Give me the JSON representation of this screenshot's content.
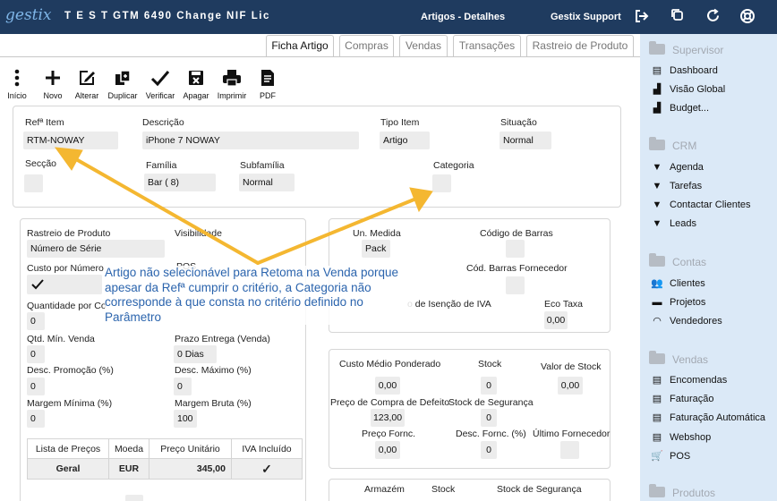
{
  "header": {
    "logo": "gestix",
    "document_title": "T E S T GTM 6490 Change NIF Lic",
    "window_title": "Artigos - Detalhes",
    "user": "Gestix Support",
    "icons": [
      "logout-icon",
      "windows-icon",
      "refresh-icon",
      "help-icon"
    ]
  },
  "tabs": [
    {
      "label": "Ficha Artigo",
      "active": true
    },
    {
      "label": "Compras",
      "active": false
    },
    {
      "label": "Vendas",
      "active": false
    },
    {
      "label": "Transações",
      "active": false
    },
    {
      "label": "Rastreio de Produto",
      "active": false
    }
  ],
  "toolbar": [
    {
      "label": "Início",
      "icon": "menu-dots-icon"
    },
    {
      "label": "Novo",
      "icon": "plus-icon"
    },
    {
      "label": "Alterar",
      "icon": "edit-icon"
    },
    {
      "label": "Duplicar",
      "icon": "duplicate-icon"
    },
    {
      "label": "Verificar",
      "icon": "check-icon"
    },
    {
      "label": "Apagar",
      "icon": "delete-icon"
    },
    {
      "label": "Imprimir",
      "icon": "print-icon"
    },
    {
      "label": "PDF",
      "icon": "pdf-icon"
    }
  ],
  "item": {
    "ref_label": "Refª Item",
    "ref_value": "RTM-NOWAY",
    "desc_label": "Descrição",
    "desc_value": "iPhone 7 NOWAY",
    "tipo_label": "Tipo Item",
    "tipo_value": "Artigo",
    "situacao_label": "Situação",
    "situacao_value": "Normal",
    "seccao_label": "Secção",
    "seccao_value": "",
    "familia_label": "Família",
    "familia_value": "Bar ( 8)",
    "subfamilia_label": "Subfamília",
    "subfamilia_value": "Normal",
    "categoria_label": "Categoria",
    "categoria_value": ""
  },
  "left_panel": {
    "rastreio_label": "Rastreio de Produto",
    "rastreio_value": "Número de Série",
    "visibilidade_label": "Visibilidade",
    "custo_numero_label": "Custo por Número",
    "pos_partial": "POS",
    "qtd_partial_label": "Quantidade por Co",
    "qtd_value": "0",
    "qtd_min_label": "Qtd. Mín. Venda",
    "qtd_min_value": "0",
    "prazo_label": "Prazo Entrega (Venda)",
    "prazo_value": "0 Dias",
    "desc_promo_label": "Desc. Promoção (%)",
    "desc_promo_value": "0",
    "desc_max_label": "Desc. Máximo (%)",
    "desc_max_value": "0",
    "margem_min_label": "Margem Mínima (%)",
    "margem_min_value": "0",
    "margem_bruta_label": "Margem Bruta (%)",
    "margem_bruta_value": "100"
  },
  "price_table": {
    "headers": [
      "Lista de Preços",
      "Moeda",
      "Preço Unitário",
      "IVA Incluído"
    ],
    "rows": [
      [
        "Geral",
        "EUR",
        "345,00",
        "✓"
      ]
    ]
  },
  "right_panel1": {
    "un_medida_label": "Un. Medida",
    "un_medida_value": "Pack",
    "codigo_barras_label": "Código de Barras",
    "cod_barras_forn_label": "Cód. Barras Fornecedor",
    "isencao_partial_label": "o de Isenção de IVA",
    "eco_taxa_label": "Eco Taxa",
    "eco_taxa_value": "0,00"
  },
  "right_panel2": {
    "custo_medio_label": "Custo Médio Ponderado",
    "custo_medio_value": "0,00",
    "stock_label": "Stock",
    "stock_value": "0",
    "valor_stock_label": "Valor de Stock",
    "valor_stock_value": "0,00",
    "preco_compra_label": "Preço de Compra de Defeito",
    "preco_compra_value": "123,00",
    "stock_seg_label": "Stock de Segurança",
    "stock_seg_value": "0",
    "preco_forn_label": "Preço Fornc.",
    "preco_forn_value": "0,00",
    "desc_forn_label": "Desc. Fornc. (%)",
    "desc_forn_value": "0",
    "ultimo_forn_label": "Último Fornecedor"
  },
  "bottom_headers": {
    "armazem": "Armazém",
    "stock": "Stock",
    "stock_seg": "Stock de Segurança"
  },
  "sidebar": {
    "sections": [
      {
        "title": "Supervisor",
        "items": [
          {
            "label": "Dashboard",
            "icon": "dashboard-icon"
          },
          {
            "label": "Visão Global",
            "icon": "bar-chart-icon"
          },
          {
            "label": "Budget...",
            "icon": "bar-chart-icon"
          }
        ]
      },
      {
        "title": "CRM",
        "items": [
          {
            "label": "Agenda",
            "icon": "funnel-icon"
          },
          {
            "label": "Tarefas",
            "icon": "funnel-icon"
          },
          {
            "label": "Contactar Clientes",
            "icon": "funnel-icon"
          },
          {
            "label": "Leads",
            "icon": "funnel-icon"
          }
        ]
      },
      {
        "title": "Contas",
        "items": [
          {
            "label": "Clientes",
            "icon": "users-icon"
          },
          {
            "label": "Projetos",
            "icon": "projects-icon"
          },
          {
            "label": "Vendedores",
            "icon": "headset-icon"
          }
        ]
      },
      {
        "title": "Vendas",
        "items": [
          {
            "label": "Encomendas",
            "icon": "document-icon"
          },
          {
            "label": "Faturação",
            "icon": "document-icon"
          },
          {
            "label": "Faturação Automática",
            "icon": "document-icon"
          },
          {
            "label": "Webshop",
            "icon": "document-icon"
          },
          {
            "label": "POS",
            "icon": "cart-icon"
          }
        ]
      },
      {
        "title": "Produtos",
        "items": []
      }
    ]
  },
  "annotation": {
    "text": "Artigo não selecionável para Retoma na Venda porque apesar da Refª cumprir o critério, a Categoria não corresponde à que consta no critério definido no Parâmetro",
    "color": "#2b64ad",
    "arrow_color": "#f4b731"
  }
}
